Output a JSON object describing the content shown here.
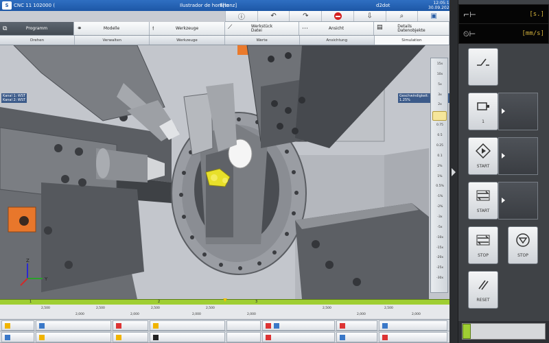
{
  "window": {
    "title_left": "CNC 11 102000 (0.0)",
    "title_mid": "Ilustrador de horário",
    "filename": "E[tenz]",
    "user": "d2dot",
    "time_line1": "12:05:11",
    "time_line2": "30.09.2024"
  },
  "toolstrip": {
    "icons": [
      "info-icon",
      "undo-icon",
      "redo-icon",
      "stop-sign-icon",
      "import-icon",
      "zoom-icon",
      "save-icon"
    ]
  },
  "ribbon": {
    "tabs": [
      {
        "label": "Programm",
        "icon": "program-icon",
        "active": true
      },
      {
        "label": "Modelle",
        "icon": "model-icon",
        "active": false
      },
      {
        "label": "Werkzeuge",
        "icon": "tool-icon",
        "active": false
      },
      {
        "label": "Werkstück\nDatei",
        "icon": "workpiece-icon",
        "active": false
      },
      {
        "label": "Ansicht",
        "icon": "view-icon",
        "active": false
      },
      {
        "label": "Details\nDatenobjekte",
        "icon": "details-icon",
        "active": false
      }
    ]
  },
  "subbar": {
    "items": [
      "Drehen",
      "Verwalten",
      "Werkzeuge",
      "Werte",
      "Ansichtung",
      "Simulation"
    ],
    "active_index": 5
  },
  "viewport": {
    "info_line1": "Kanal 1: WST",
    "info_line2": "Kanal 2: WST",
    "info_right": "Geschwindigkeit: 1 % 1.25%"
  },
  "zoom_scale": {
    "labels": [
      "15x",
      "10x",
      "5x",
      "3x",
      "2x",
      "1x",
      "0.75",
      "0.5",
      "0.25",
      "0.1",
      "2%",
      "1%",
      "0.5%",
      "-1%",
      "-2%",
      "-3x",
      "-5x",
      "-10x",
      "-15x",
      "-20x",
      "-25x",
      "-30x"
    ],
    "selected": "1x"
  },
  "timeline": {
    "ticks": [
      "1",
      "2",
      "3"
    ],
    "progress_fraction": 0.5
  },
  "ruler": {
    "values_top": [
      "2,500",
      "2,500",
      "2,500",
      "2,500",
      "2,500",
      "2,500"
    ],
    "values_bottom": [
      "2,000",
      "2,000",
      "2,000",
      "2,000",
      "2,000",
      "2,000"
    ]
  },
  "right_panel": {
    "display1": {
      "label": "⌐⊢",
      "value": "[s.]"
    },
    "display2": {
      "label": "⏲⊢",
      "value": "[mm/s]"
    },
    "buttons": [
      {
        "name": "switch-button",
        "label": "",
        "icon": "switch-icon",
        "has_side": false
      },
      {
        "name": "motor-button",
        "label": "1",
        "icon": "motor-icon",
        "has_side": true
      },
      {
        "name": "start-button",
        "label": "START",
        "icon": "diamond-start-icon",
        "has_side": true
      },
      {
        "name": "cycle-start-button",
        "label": "START",
        "icon": "cycle-icon",
        "has_side": true
      },
      {
        "name": "cycle-stop-button",
        "label": "STOP",
        "icon": "cycle-icon",
        "has_side": false
      },
      {
        "name": "stop-button",
        "label": "STOP",
        "icon": "stop-circle-icon",
        "has_side": false
      },
      {
        "name": "reset-button",
        "label": "RESET",
        "icon": "reset-icon",
        "has_side": false
      }
    ]
  }
}
